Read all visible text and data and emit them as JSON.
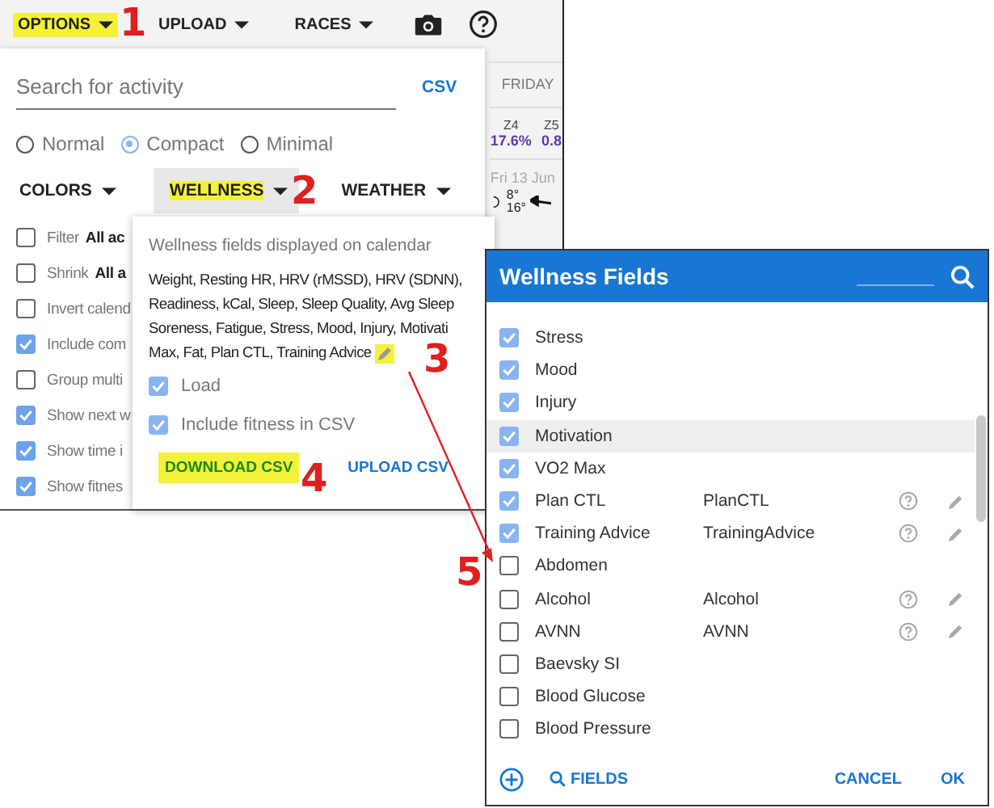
{
  "toolbar": {
    "items": [
      {
        "kind": "menu",
        "label": "OPTIONS",
        "highlighted": true
      },
      {
        "kind": "menu",
        "label": "UPLOAD",
        "highlighted": false
      },
      {
        "kind": "menu",
        "label": "RACES",
        "highlighted": false
      },
      {
        "kind": "camera"
      },
      {
        "kind": "help"
      }
    ]
  },
  "options": {
    "search": {
      "placeholder": "Search for activity"
    },
    "csv_link": "CSV",
    "layouts": [
      {
        "label": "Normal",
        "selected": false
      },
      {
        "label": "Compact",
        "selected": true
      },
      {
        "label": "Minimal",
        "selected": false
      }
    ],
    "tabs": [
      {
        "label": "COLORS",
        "selected": false,
        "highlighted": false
      },
      {
        "label": "WELLNESS",
        "selected": true,
        "highlighted": true
      },
      {
        "label": "WEATHER",
        "selected": false,
        "highlighted": false
      }
    ],
    "settings": [
      {
        "label": "Filter",
        "value": "All ac",
        "checked": false
      },
      {
        "label": "Shrink",
        "value": "All a",
        "checked": false
      },
      {
        "label": "Invert calend",
        "checked": false
      },
      {
        "label": "Include com",
        "checked": true
      },
      {
        "label": "Group multi",
        "checked": false
      },
      {
        "label": "Show next w",
        "checked": true
      },
      {
        "label": "Show time i",
        "checked": true
      },
      {
        "label": "Show fitnes",
        "checked": true
      }
    ]
  },
  "calendar": {
    "day": "FRIDAY",
    "zones": [
      {
        "name": "Z4",
        "value": "17.6%"
      },
      {
        "name": "Z5",
        "value": "0.8"
      }
    ],
    "date": "Fri 13 Jun",
    "temp_low": "8°",
    "temp_high": "16°"
  },
  "wellness_popup": {
    "title": "Wellness fields displayed on calendar",
    "lines": [
      "Weight, Resting HR, HRV (rMSSD), HRV (SDNN),",
      "Readiness, kCal, Sleep, Sleep Quality, Avg Sleep",
      "Soreness, Fatigue, Stress, Mood, Injury, Motivati",
      "Max, Fat, Plan CTL, Training Advice"
    ],
    "edit_highlighted": true,
    "options": [
      {
        "label": "Load",
        "checked": true
      },
      {
        "label": "Include fitness in CSV",
        "checked": true
      }
    ],
    "buttons": [
      {
        "label": "DOWNLOAD CSV",
        "highlighted": true
      },
      {
        "label": "UPLOAD CSV",
        "highlighted": false
      }
    ]
  },
  "dialog": {
    "title": "Wellness Fields",
    "fields": [
      {
        "name": "Stress",
        "checked": true,
        "selected": false
      },
      {
        "name": "Mood",
        "checked": true,
        "selected": false
      },
      {
        "name": "Injury",
        "checked": true,
        "selected": false
      },
      {
        "name": "Motivation",
        "checked": true,
        "selected": true
      },
      {
        "name": "VO2 Max",
        "checked": true,
        "selected": false
      },
      {
        "name": "Plan CTL",
        "code": "PlanCTL",
        "checked": true,
        "selected": false
      },
      {
        "name": "Training Advice",
        "code": "TrainingAdvice",
        "checked": true,
        "selected": false
      },
      {
        "name": "Abdomen",
        "checked": false,
        "selected": false
      },
      {
        "name": "Alcohol",
        "code": "Alcohol",
        "checked": false,
        "selected": false
      },
      {
        "name": "AVNN",
        "code": "AVNN",
        "checked": false,
        "selected": false
      },
      {
        "name": "Baevsky SI",
        "checked": false,
        "selected": false
      },
      {
        "name": "Blood Glucose",
        "checked": false,
        "selected": false
      },
      {
        "name": "Blood Pressure",
        "checked": false,
        "selected": false
      }
    ],
    "footer": {
      "fields_button": "FIELDS",
      "cancel": "CANCEL",
      "ok": "OK"
    }
  },
  "annotations": [
    {
      "label": "1"
    },
    {
      "label": "2"
    },
    {
      "label": "3"
    },
    {
      "label": "4"
    },
    {
      "label": "5"
    }
  ]
}
